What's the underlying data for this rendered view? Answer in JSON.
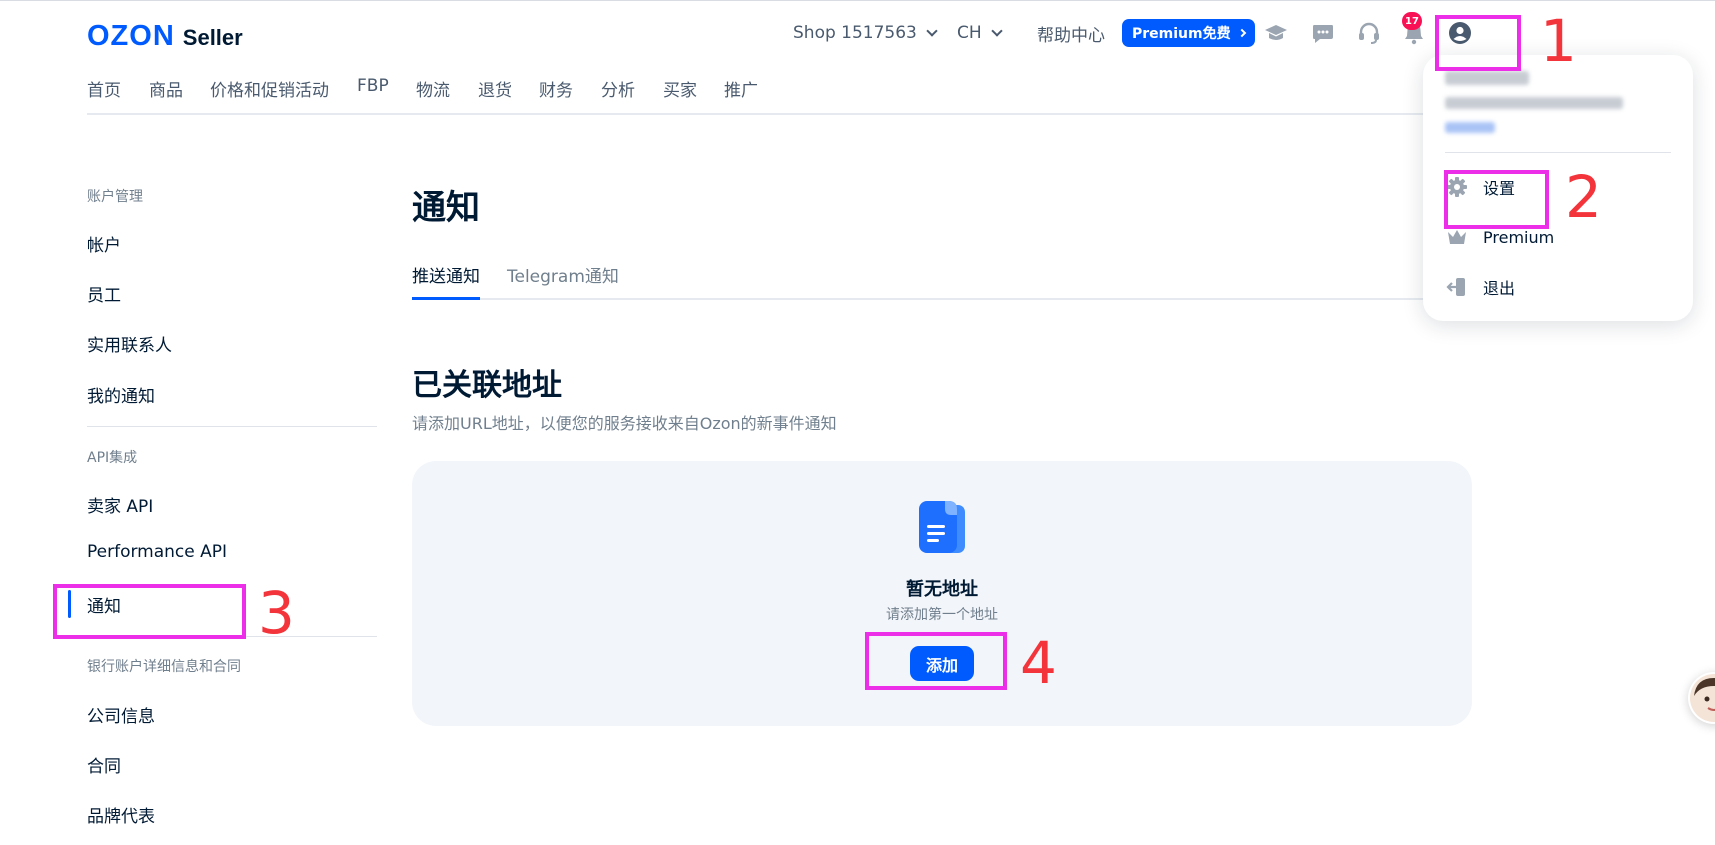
{
  "header": {
    "logo_ozon": "OZON",
    "logo_seller": "Seller",
    "shop": "Shop 1517563",
    "language": "CH",
    "help": "帮助中心",
    "premium_button": "Premium免费",
    "notifications_count": "17",
    "icons": [
      "graduation-cap-icon",
      "chat-icon",
      "headset-icon",
      "bell-icon",
      "user-icon"
    ]
  },
  "nav": {
    "items": [
      "首页",
      "商品",
      "价格和促销活动",
      "FBP",
      "物流",
      "退货",
      "财务",
      "分析",
      "买家",
      "推广"
    ]
  },
  "sidebar": {
    "section1_title": "账户管理",
    "section1_items": [
      "帐户",
      "员工",
      "实用联系人",
      "我的通知"
    ],
    "section2_title": "API集成",
    "section2_items": [
      "卖家 API",
      "Performance API",
      "通知"
    ],
    "section3_title": "银行账户详细信息和合同",
    "section3_items": [
      "公司信息",
      "合同",
      "品牌代表"
    ],
    "active_item": "通知"
  },
  "main": {
    "title": "通知",
    "tabs": [
      "推送通知",
      "Telegram通知"
    ],
    "active_tab": "推送通知",
    "section_title": "已关联地址",
    "section_desc": "请添加URL地址，以便您的服务接收来自Ozon的新事件通知",
    "empty_title": "暂无地址",
    "empty_subtitle": "请添加第一个地址",
    "add_button": "添加"
  },
  "dropdown": {
    "items": [
      {
        "label": "设置",
        "icon": "gear-icon"
      },
      {
        "label": "Premium",
        "icon": "crown-icon"
      },
      {
        "label": "退出",
        "icon": "logout-icon"
      }
    ]
  },
  "annotations": [
    "1",
    "2",
    "3",
    "4"
  ],
  "colors": {
    "accent": "#005bff",
    "annotation_box": "#ec2ee8",
    "annotation_number": "#f3343a",
    "badge": "#f91155"
  }
}
